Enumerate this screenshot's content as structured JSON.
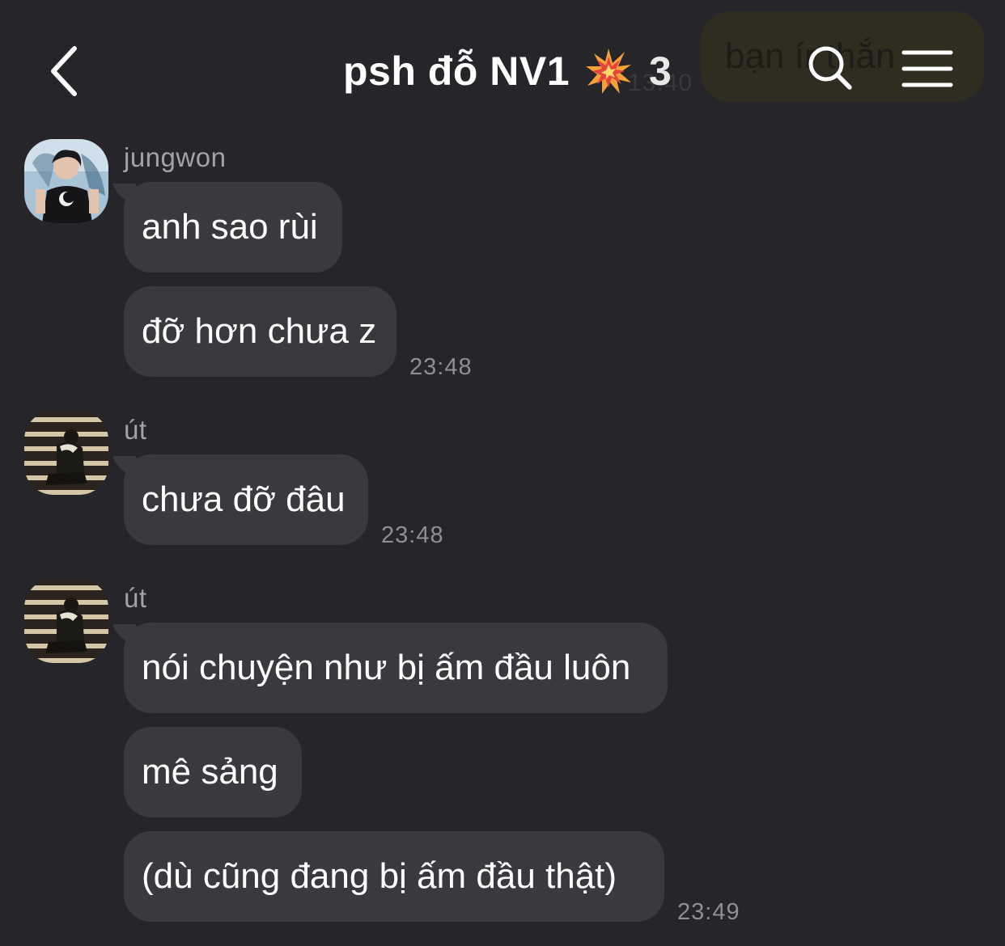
{
  "header": {
    "title": "psh đỗ NV1",
    "member_count": "3",
    "back_icon": "chevron-left-icon",
    "title_emoji": "collision-emoji",
    "search_icon": "search-icon",
    "menu_icon": "hamburger-menu-icon"
  },
  "background_peek": {
    "outgoing_text": "bạn ír thắn",
    "time": "13:40"
  },
  "messages": [
    {
      "sender": "jungwon",
      "bubbles": [
        "anh sao rùi",
        "đỡ hơn chưa z"
      ],
      "time": "23:48"
    },
    {
      "sender": "út",
      "bubbles": [
        "chưa đỡ đâu"
      ],
      "time": "23:48"
    },
    {
      "sender": "út",
      "bubbles": [
        "nói chuyện như bị ấm đầu luôn",
        "mê sảng",
        "(dù cũng đang bị ấm đầu thật)"
      ],
      "time": "23:49"
    }
  ],
  "colors": {
    "background": "#26262a",
    "bubble": "#3a3a3e",
    "text": "#ffffff",
    "secondary_text": "#8e8e93"
  }
}
